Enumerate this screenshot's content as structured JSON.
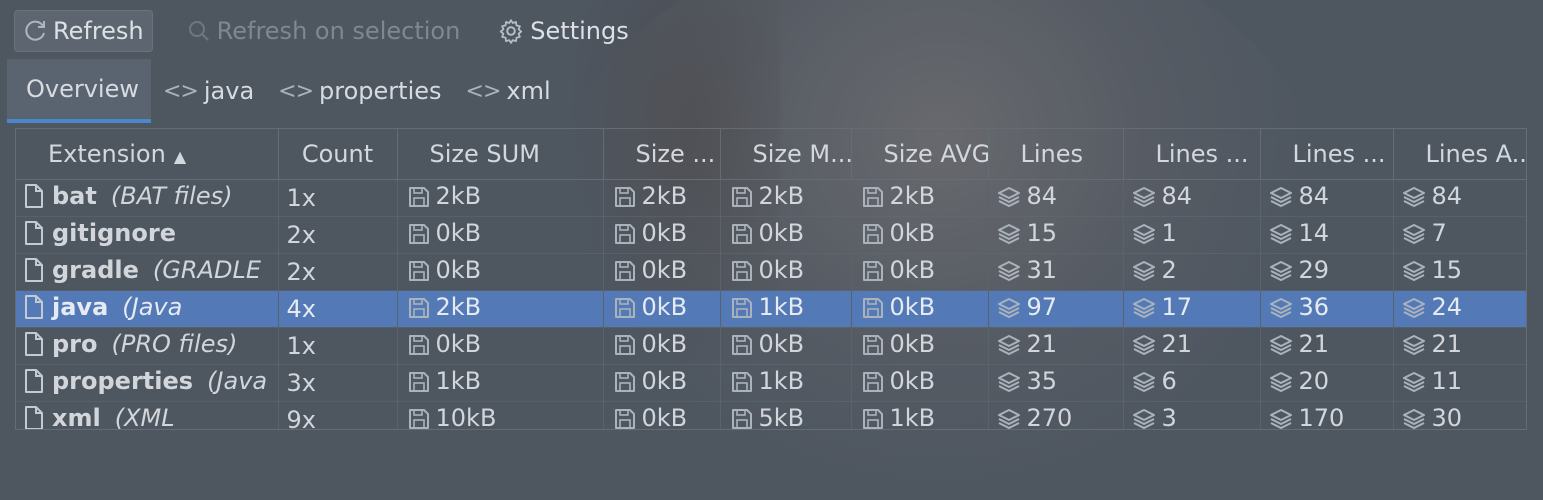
{
  "toolbar": {
    "refresh_label": "Refresh",
    "refresh_on_selection_label": "Refresh on selection",
    "settings_label": "Settings"
  },
  "tabs": [
    {
      "label": "Overview",
      "active": true
    },
    {
      "label": "java",
      "active": false
    },
    {
      "label": "properties",
      "active": false
    },
    {
      "label": "xml",
      "active": false
    }
  ],
  "table": {
    "columns": [
      "Extension",
      "Count",
      "Size SUM",
      "Size ...",
      "Size M...",
      "Size AVG",
      "Lines",
      "Lines ...",
      "Lines ...",
      "Lines A..."
    ],
    "sort_column": "Extension",
    "sort_direction": "ascending",
    "rows": [
      {
        "ext": "bat",
        "desc": "(BAT files)",
        "count": "1x",
        "size_sum": "2kB",
        "size_min": "2kB",
        "size_max": "2kB",
        "size_avg": "2kB",
        "lines": "84",
        "lines_min": "84",
        "lines_max": "84",
        "lines_avg": "84",
        "selected": false
      },
      {
        "ext": "gitignore",
        "desc": "",
        "count": "2x",
        "size_sum": "0kB",
        "size_min": "0kB",
        "size_max": "0kB",
        "size_avg": "0kB",
        "lines": "15",
        "lines_min": "1",
        "lines_max": "14",
        "lines_avg": "7",
        "selected": false
      },
      {
        "ext": "gradle",
        "desc": "(GRADLE",
        "count": "2x",
        "size_sum": "0kB",
        "size_min": "0kB",
        "size_max": "0kB",
        "size_avg": "0kB",
        "lines": "31",
        "lines_min": "2",
        "lines_max": "29",
        "lines_avg": "15",
        "selected": false
      },
      {
        "ext": "java",
        "desc": "(Java",
        "count": "4x",
        "size_sum": "2kB",
        "size_min": "0kB",
        "size_max": "1kB",
        "size_avg": "0kB",
        "lines": "97",
        "lines_min": "17",
        "lines_max": "36",
        "lines_avg": "24",
        "selected": true
      },
      {
        "ext": "pro",
        "desc": "(PRO files)",
        "count": "1x",
        "size_sum": "0kB",
        "size_min": "0kB",
        "size_max": "0kB",
        "size_avg": "0kB",
        "lines": "21",
        "lines_min": "21",
        "lines_max": "21",
        "lines_avg": "21",
        "selected": false
      },
      {
        "ext": "properties",
        "desc": "(Java",
        "count": "3x",
        "size_sum": "1kB",
        "size_min": "0kB",
        "size_max": "1kB",
        "size_avg": "0kB",
        "lines": "35",
        "lines_min": "6",
        "lines_max": "20",
        "lines_avg": "11",
        "selected": false
      },
      {
        "ext": "xml",
        "desc": "(XML",
        "count": "9x",
        "size_sum": "10kB",
        "size_min": "0kB",
        "size_max": "5kB",
        "size_avg": "1kB",
        "lines": "270",
        "lines_min": "3",
        "lines_max": "170",
        "lines_avg": "30",
        "selected": false
      }
    ]
  },
  "icons": {
    "refresh": "refresh-icon",
    "search": "search-icon",
    "settings": "gear-icon",
    "code": "code-brackets-icon",
    "file": "file-icon",
    "size": "floppy-disk-icon",
    "lines": "layers-icon"
  },
  "colors": {
    "background": "#4e5660",
    "selection": "#5379b7",
    "tab_underline": "#4a88c7"
  }
}
